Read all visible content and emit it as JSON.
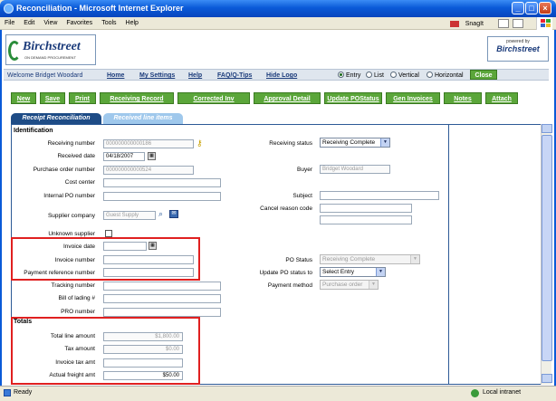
{
  "window": {
    "title": "Reconciliation - Microsoft Internet Explorer"
  },
  "menu": [
    "File",
    "Edit",
    "View",
    "Favorites",
    "Tools",
    "Help"
  ],
  "snagit_label": "SnagIt",
  "logo": {
    "brand": "Birchstreet",
    "tagline": "ON DEMAND PROCUREMENT",
    "powered_by": "powered by",
    "brand_small": "Birchstreet"
  },
  "nav": {
    "welcome": "Welcome Bridget Woodard",
    "links": [
      "Home",
      "My Settings",
      "Help",
      "FAQ/Q-Tips",
      "Hide Logo"
    ],
    "view_options": [
      "Entry",
      "List",
      "Vertical",
      "Horizontal"
    ],
    "selected_view": "Entry",
    "close_label": "Close"
  },
  "toolbar": [
    "New",
    "Save",
    "Print",
    "Receiving Record",
    "Corrected Inv",
    "Approval Detail",
    "Update POStatus",
    "Gen Invoices",
    "Notes",
    "Attach"
  ],
  "tabs": [
    "Receipt Reconciliation",
    "Received line items"
  ],
  "sections": {
    "identification": "Identification",
    "totals": "Totals"
  },
  "form": {
    "receiving_number": {
      "label": "Receiving number",
      "value": "000000000000186"
    },
    "received_date": {
      "label": "Received date",
      "value": "04/18/2007"
    },
    "purchase_order_number": {
      "label": "Purchase order number",
      "value": "000000000000524"
    },
    "cost_center": {
      "label": "Cost center",
      "value": ""
    },
    "internal_po_number": {
      "label": "Internal PO number",
      "value": ""
    },
    "supplier_company": {
      "label": "Supplier company",
      "value": "Guest Supply"
    },
    "unknown_supplier": {
      "label": "Unknown supplier"
    },
    "invoice_date": {
      "label": "Invoice date",
      "value": ""
    },
    "invoice_number": {
      "label": "Invoice number",
      "value": ""
    },
    "payment_reference_number": {
      "label": "Payment reference number",
      "value": ""
    },
    "tracking_number": {
      "label": "Tracking number",
      "value": ""
    },
    "bill_of_lading": {
      "label": "Bill of lading #",
      "value": ""
    },
    "pro_number": {
      "label": "PRO number",
      "value": ""
    },
    "receiving_status": {
      "label": "Receiving status",
      "value": "Receiving Complete"
    },
    "buyer": {
      "label": "Buyer",
      "value": "Bridget Woodard"
    },
    "subject": {
      "label": "Subject",
      "value": ""
    },
    "cancel_reason_code": {
      "label": "Cancel reason code",
      "value": ""
    },
    "po_status": {
      "label": "PO Status",
      "value": "Receiving Complete"
    },
    "update_po_status_to": {
      "label": "Update PO status to",
      "value": "Select Entry"
    },
    "payment_method": {
      "label": "Payment method",
      "value": "Purchase order"
    },
    "total_line_amount": {
      "label": "Total line amount",
      "value": "$1,800.00"
    },
    "tax_amount": {
      "label": "Tax amount",
      "value": "$0.00"
    },
    "invoice_tax_amt": {
      "label": "Invoice tax amt",
      "value": ""
    },
    "actual_freight_amt": {
      "label": "Actual freight amt",
      "value": "$50.00"
    }
  },
  "status": {
    "left": "Ready",
    "zone": "Local intranet"
  }
}
